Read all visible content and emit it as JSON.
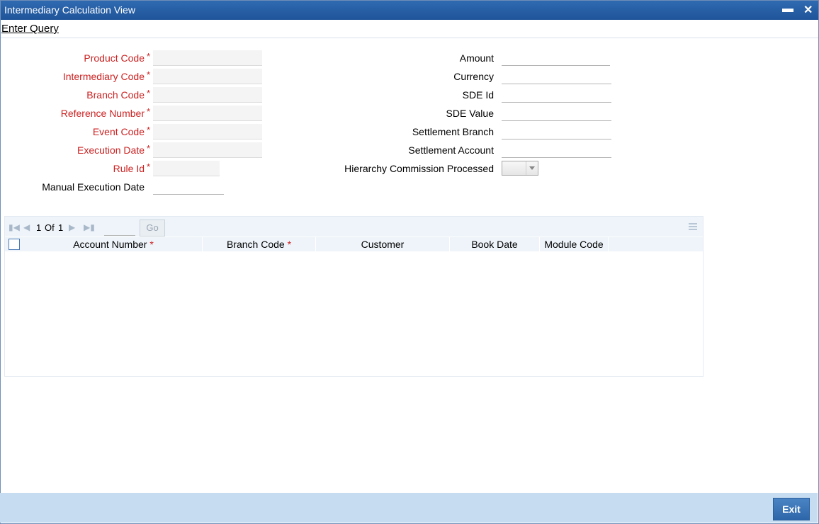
{
  "window": {
    "title": "Intermediary Calculation View",
    "minimize_icon": "minimize-icon",
    "close_icon": "close-icon"
  },
  "menu": {
    "enter_query": "Enter Query"
  },
  "form": {
    "left": [
      {
        "label": "Product Code",
        "required": true,
        "value": ""
      },
      {
        "label": "Intermediary Code",
        "required": true,
        "value": ""
      },
      {
        "label": "Branch Code",
        "required": true,
        "value": ""
      },
      {
        "label": "Reference Number",
        "required": true,
        "value": ""
      },
      {
        "label": "Event Code",
        "required": true,
        "value": ""
      },
      {
        "label": "Execution Date",
        "required": true,
        "value": ""
      },
      {
        "label": "Rule Id",
        "required": true,
        "value": ""
      },
      {
        "label": "Manual Execution Date",
        "required": false,
        "value": ""
      }
    ],
    "right": [
      {
        "label": "Amount",
        "value": ""
      },
      {
        "label": "Currency",
        "value": ""
      },
      {
        "label": "SDE Id",
        "value": ""
      },
      {
        "label": "SDE Value",
        "value": ""
      },
      {
        "label": "Settlement Branch",
        "value": ""
      },
      {
        "label": "Settlement Account",
        "value": ""
      },
      {
        "label": "Hierarchy Commission Processed",
        "value": ""
      }
    ],
    "required_mark": "*"
  },
  "grid": {
    "page_current": "1",
    "page_of": "Of",
    "page_total": "1",
    "go_label": "Go",
    "columns": [
      {
        "label": "Account Number",
        "required": true
      },
      {
        "label": "Branch Code",
        "required": true
      },
      {
        "label": "Customer",
        "required": false
      },
      {
        "label": "Book Date",
        "required": false
      },
      {
        "label": "Module Code",
        "required": false
      }
    ],
    "rows": []
  },
  "footer": {
    "exit_label": "Exit"
  }
}
